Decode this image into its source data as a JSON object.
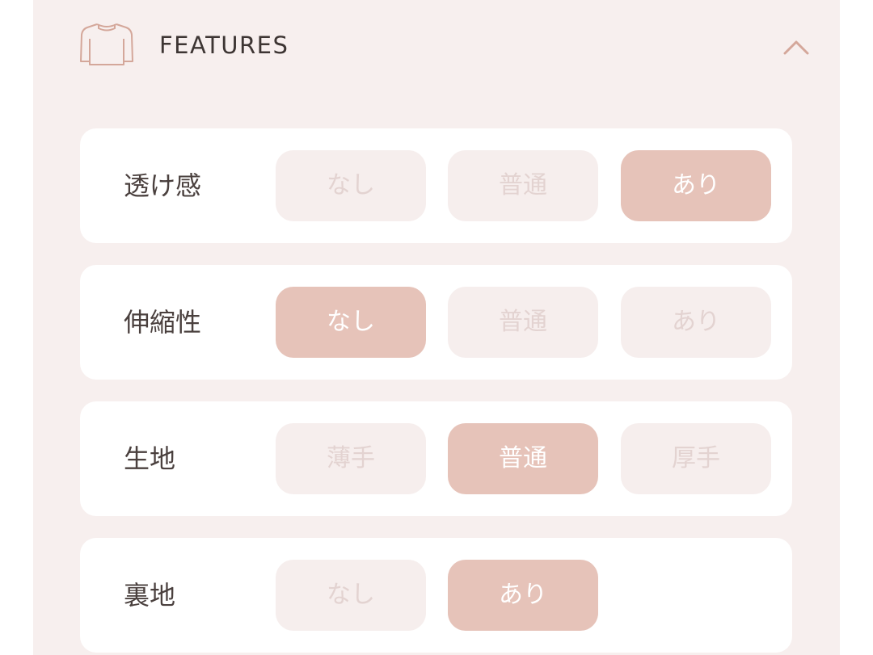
{
  "header": {
    "title": "FEATURES",
    "icon": "shirt-icon",
    "toggle_icon": "chevron-up-icon",
    "expanded": true
  },
  "colors": {
    "panel_bg": "#f7efee",
    "row_bg": "#ffffff",
    "option_bg": "#f6eeed",
    "option_text": "#e3d3d1",
    "selected_bg": "#e6c3b9",
    "selected_text": "#ffffff",
    "accent": "#d4a79a"
  },
  "features": [
    {
      "label": "透け感",
      "options": [
        "なし",
        "普通",
        "あり"
      ],
      "selected": 2
    },
    {
      "label": "伸縮性",
      "options": [
        "なし",
        "普通",
        "あり"
      ],
      "selected": 0
    },
    {
      "label": "生地",
      "options": [
        "薄手",
        "普通",
        "厚手"
      ],
      "selected": 1
    },
    {
      "label": "裏地",
      "options": [
        "なし",
        "あり"
      ],
      "selected": 1
    }
  ]
}
